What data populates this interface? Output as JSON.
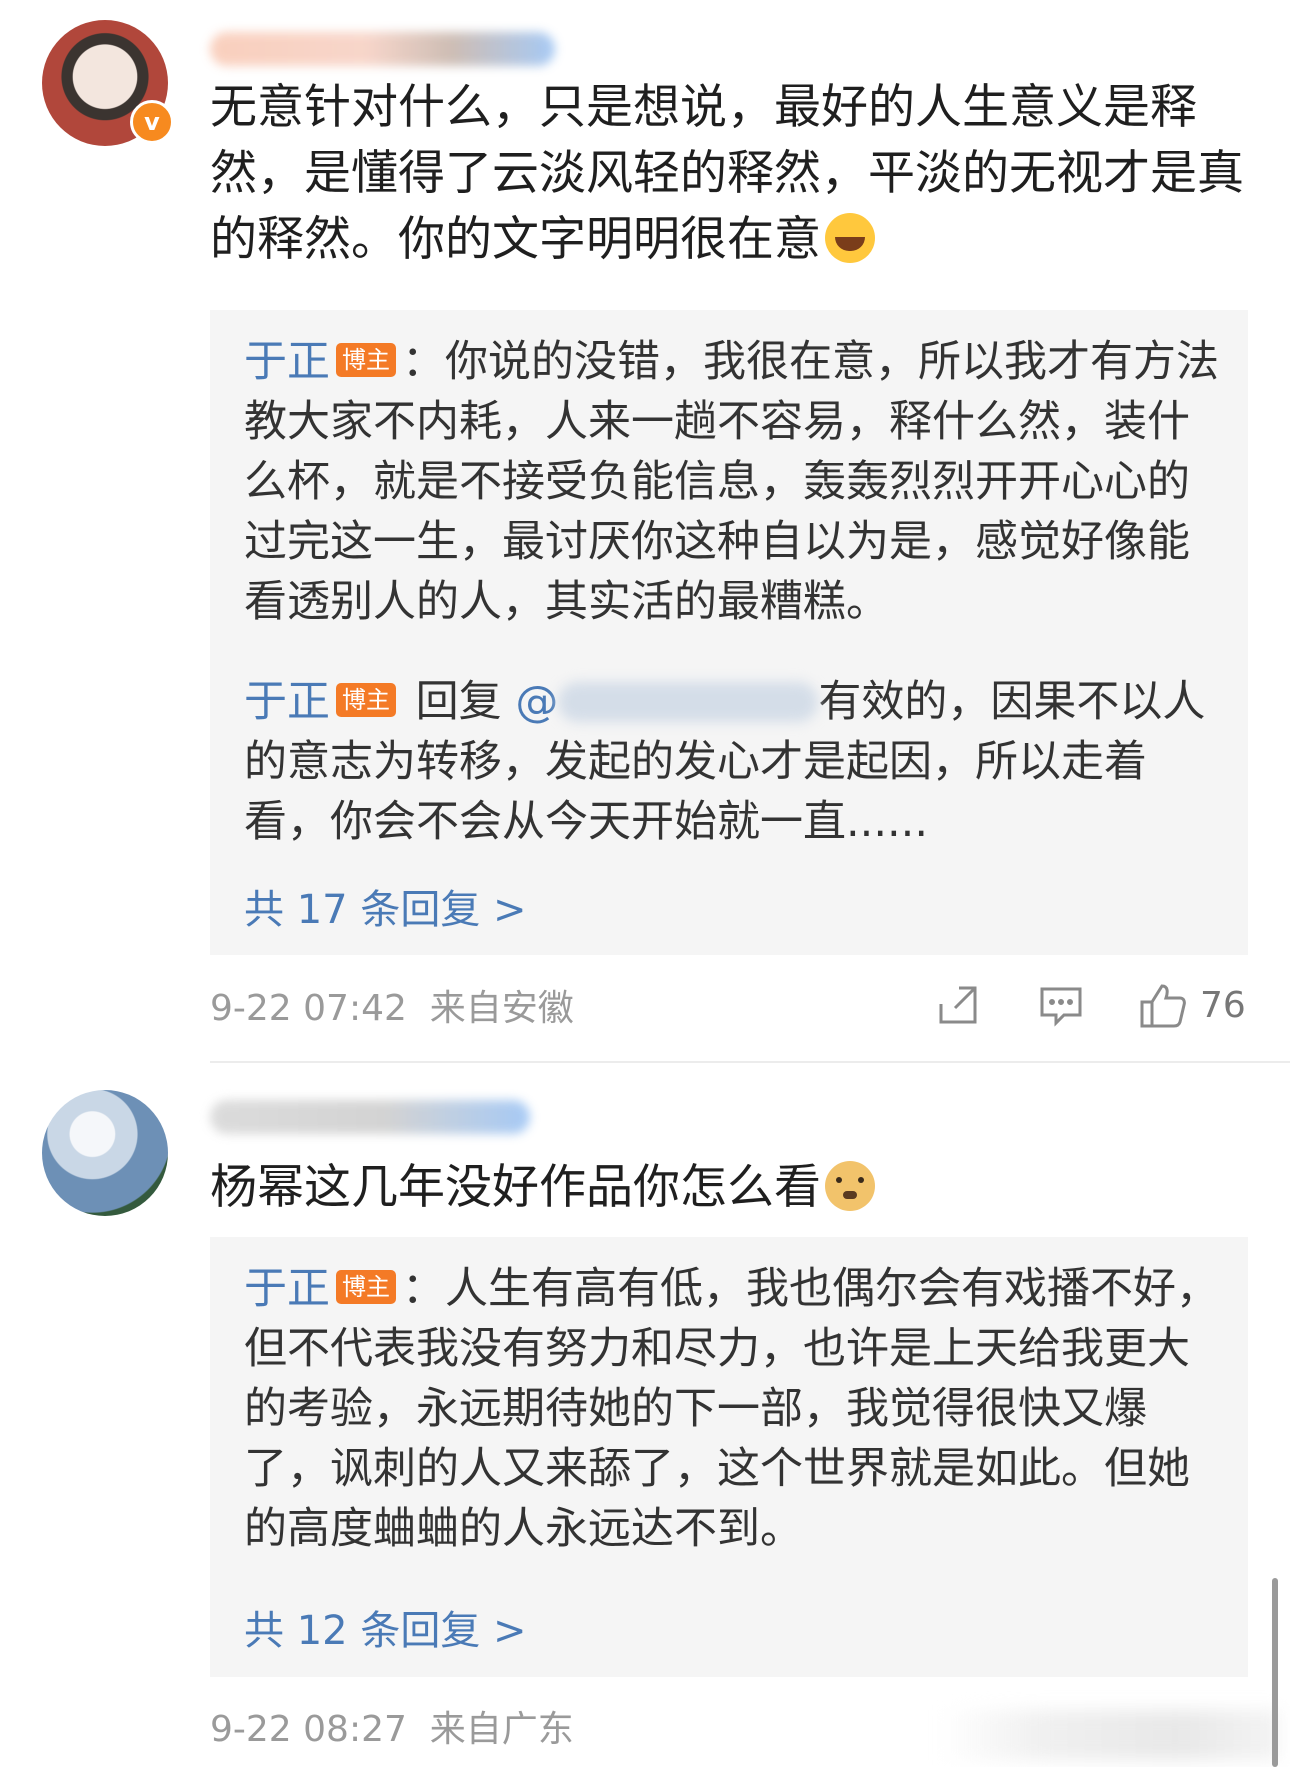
{
  "comments": [
    {
      "username": "",
      "verified": true,
      "text": "无意针对什么，只是想说，最好的人生意义是释然，是懂得了云淡风轻的释然，平淡的无视才是真的释然。你的文字明明很在意",
      "emoji": "laugh-cry-emoji",
      "replies": [
        {
          "author": "于正",
          "tag": "博主",
          "text": "：你说的没错，我很在意，所以我才有方法教大家不内耗，人来一趟不容易，释什么然，装什么杯，就是不接受负能信息，轰轰烈烈开开心心的过完这一生，最讨厌你这种自以为是，感觉好像能看透别人的人，其实活的最糟糕。"
        },
        {
          "author": "于正",
          "tag": "博主",
          "reply_word": "回复",
          "mention_prefix": "@",
          "text": "有效的，因果不以人的意志为转移，发起的发心才是起因，所以走着看，你会不会从今天开始就一直......"
        }
      ],
      "replies_link": "共 17 条回复 >",
      "time": "9-22 07:42",
      "location": "来自安徽",
      "likes": "76"
    },
    {
      "username": "",
      "text": "杨幂这几年没好作品你怎么看",
      "emoji": "doge-emoji",
      "replies": [
        {
          "author": "于正",
          "tag": "博主",
          "text": "：人生有高有低，我也偶尔会有戏播不好，但不代表我没有努力和尽力，也许是上天给我更大的考验，永远期待她的下一部，我觉得很快又爆了，讽刺的人又来舔了，这个世界就是如此。但她的高度蛐蛐的人永远达不到。"
        }
      ],
      "replies_link": "共 12 条回复 >",
      "time": "9-22 08:27",
      "location": "来自广东"
    }
  ],
  "icons": {
    "share": "share-icon",
    "comment": "comment-icon",
    "like": "like-icon"
  },
  "colors": {
    "link_blue": "#4a7ab6",
    "blogger_tag": "#f47a26",
    "verified_badge": "#f78a1f"
  }
}
